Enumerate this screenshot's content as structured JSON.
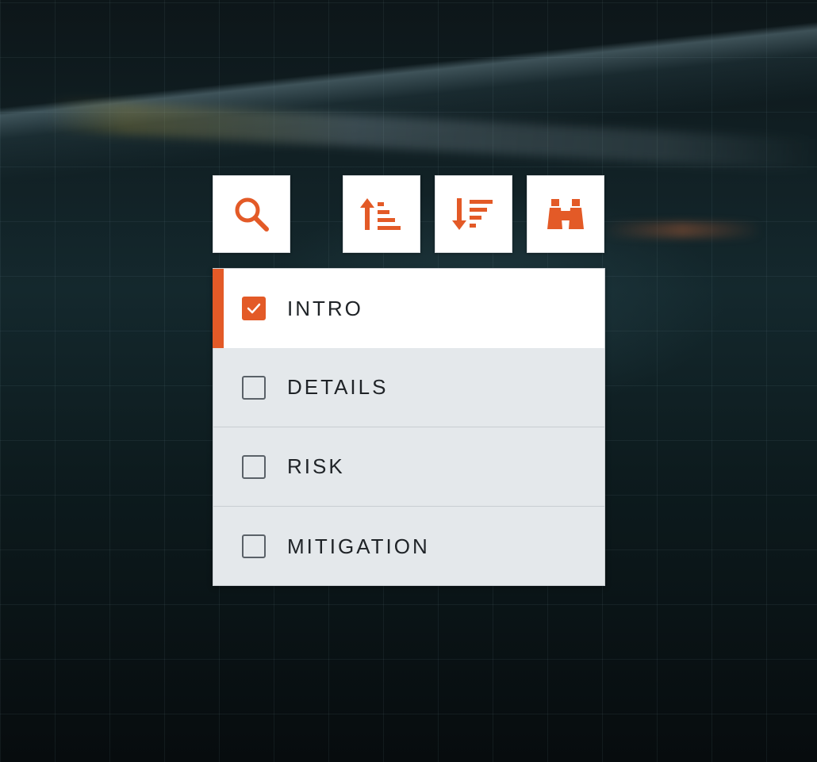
{
  "colors": {
    "accent": "#e35a27",
    "panel": "#e4e8eb",
    "active_item": "#ffffff",
    "text": "#1f2327",
    "checkbox_border": "#5a6168"
  },
  "toolbar": {
    "buttons": [
      {
        "icon": "search-icon"
      },
      {
        "icon": "sort-ascending-icon"
      },
      {
        "icon": "sort-descending-icon"
      },
      {
        "icon": "binoculars-icon"
      }
    ]
  },
  "sections": {
    "items": [
      {
        "label": "INTRO",
        "checked": true,
        "active": true
      },
      {
        "label": "DETAILS",
        "checked": false,
        "active": false
      },
      {
        "label": "RISK",
        "checked": false,
        "active": false
      },
      {
        "label": "MITIGATION",
        "checked": false,
        "active": false
      }
    ]
  }
}
